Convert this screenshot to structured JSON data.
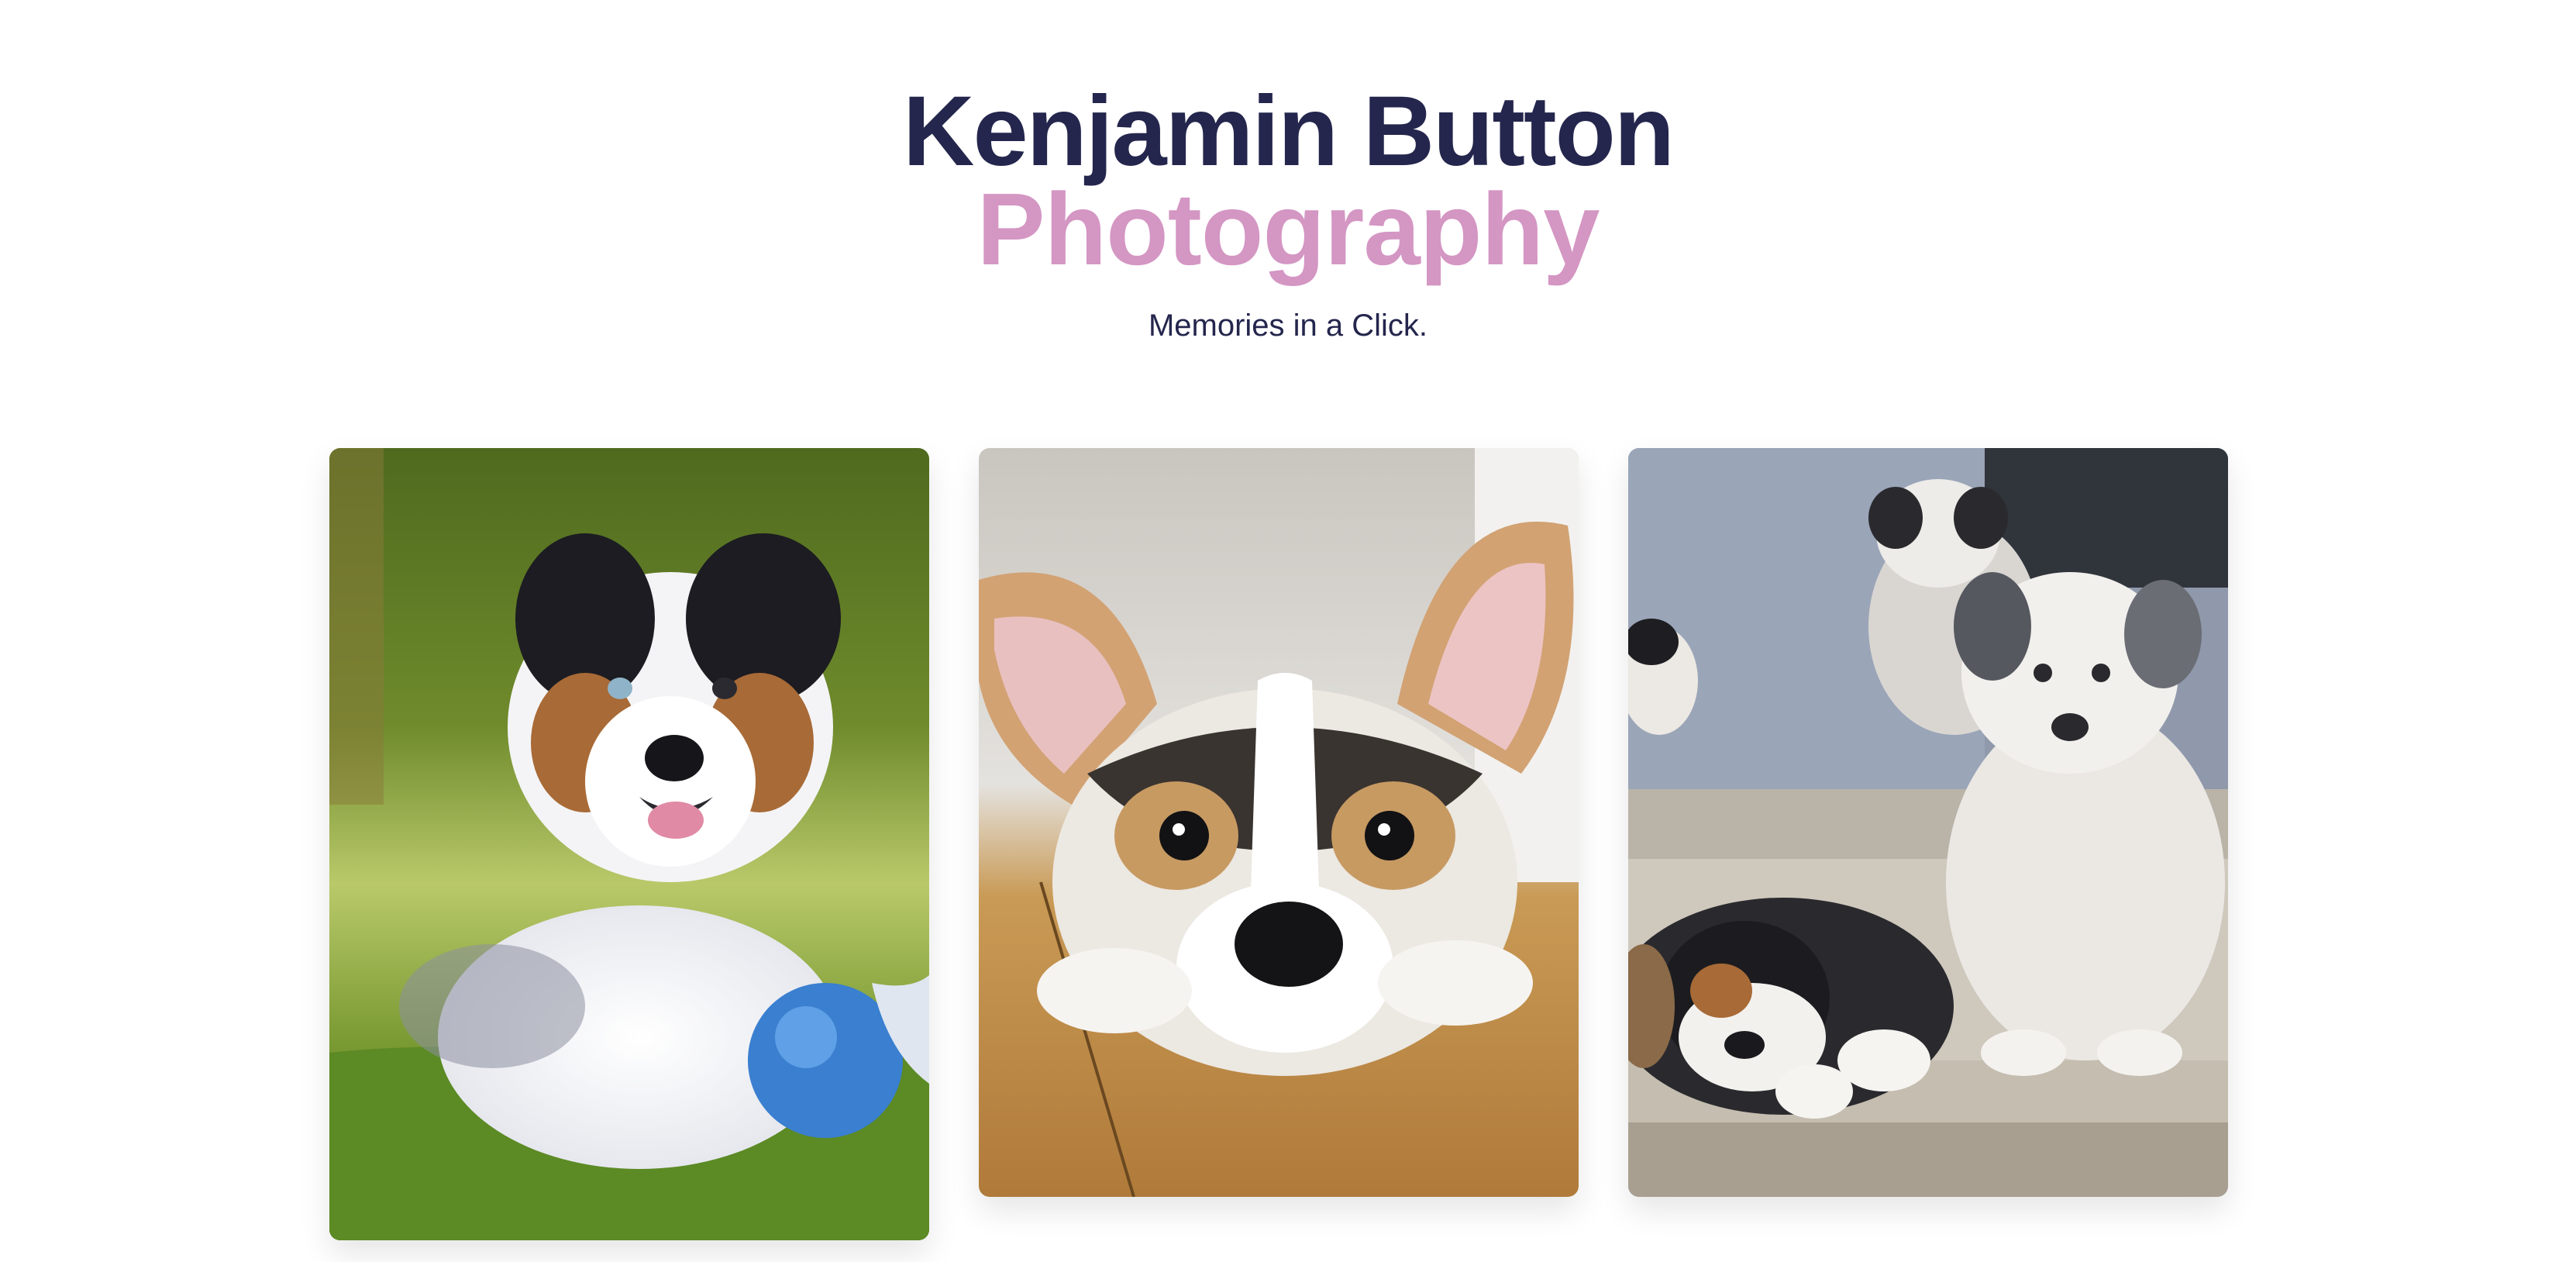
{
  "header": {
    "title_line1": "Kenjamin Button",
    "title_line2": "Photography",
    "tagline": "Memories in a Click."
  },
  "gallery": {
    "photos": [
      {
        "subject": "australian-shepherd-puppy-on-grass"
      },
      {
        "subject": "corgi-puppy-on-wood-floor"
      },
      {
        "subject": "australian-shepherd-puppies-on-steps"
      }
    ]
  },
  "colors": {
    "title_primary": "#24264d",
    "title_accent": "#d496c3",
    "background": "#ffffff"
  }
}
